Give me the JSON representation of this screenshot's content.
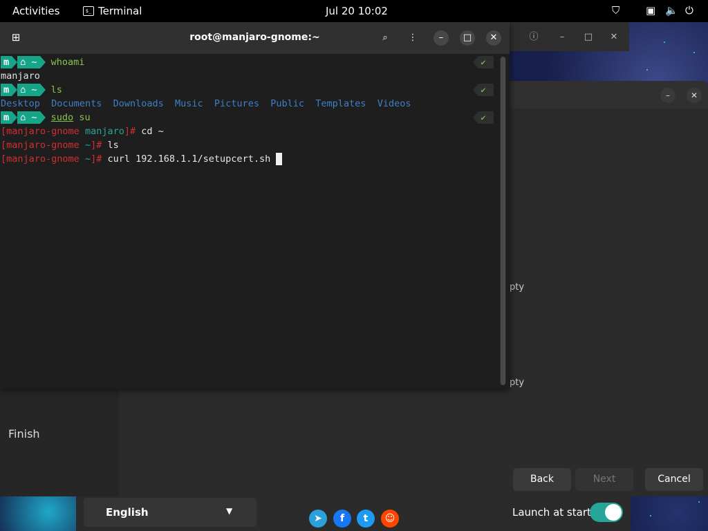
{
  "topbar": {
    "activities": "Activities",
    "app_name": "Terminal",
    "app_icon_glyph": "$_",
    "clock": "Jul 20  10:02",
    "tray_icons": [
      "shield-icon",
      "network-icon",
      "volume-icon",
      "power-icon"
    ]
  },
  "terminal": {
    "title": "root@manjaro-gnome:~",
    "lines": {
      "l1": {
        "seg_m": "m",
        "seg_h": "⌂ ~",
        "cmd": "whoami"
      },
      "l2": {
        "text": "manjaro"
      },
      "l3": {
        "seg_m": "m",
        "seg_h": "⌂ ~",
        "cmd": "ls"
      },
      "l4": {
        "dirs": [
          "Desktop",
          "Documents",
          "Downloads",
          "Music",
          "Pictures",
          "Public",
          "Templates",
          "Videos"
        ]
      },
      "l5": {
        "seg_m": "m",
        "seg_h": "⌂ ~",
        "cmd_sudo": "sudo",
        "cmd_rest": " su"
      },
      "l6": {
        "bracket_open": "[",
        "user_host": "manjaro-gnome",
        "space": " ",
        "cwd": "manjaro",
        "bracket_close": "]",
        "hash": "# ",
        "cmd": "cd ~"
      },
      "l7": {
        "bracket_open": "[",
        "user_host": "manjaro-gnome",
        "space": " ",
        "cwd": "~",
        "bracket_close": "]",
        "hash": "# ",
        "cmd": "ls"
      },
      "l8": {
        "bracket_open": "[",
        "user_host": "manjaro-gnome",
        "space": " ",
        "cwd": "~",
        "bracket_close": "]",
        "hash": "# ",
        "cmd": "curl 192.168.1.1/setupcert.sh "
      }
    },
    "check_glyph": "✔"
  },
  "installer": {
    "sidebar_finish": "Finish",
    "pty_1": "pty",
    "pty_2": "pty",
    "back": "Back",
    "next": "Next",
    "cancel": "Cancel"
  },
  "welcome": {
    "language": "English",
    "launch_at_start": "Launch at start",
    "launch_enabled": true,
    "social_icons": [
      "telegram-icon",
      "facebook-icon",
      "twitter-icon",
      "reddit-icon"
    ]
  },
  "colors": {
    "powerline_teal": "#17a589",
    "prompt_red": "#d32f2f",
    "dir_blue": "#3f7fc6",
    "cmd_green": "#8bc34a",
    "toggle_on": "#26a69a"
  }
}
